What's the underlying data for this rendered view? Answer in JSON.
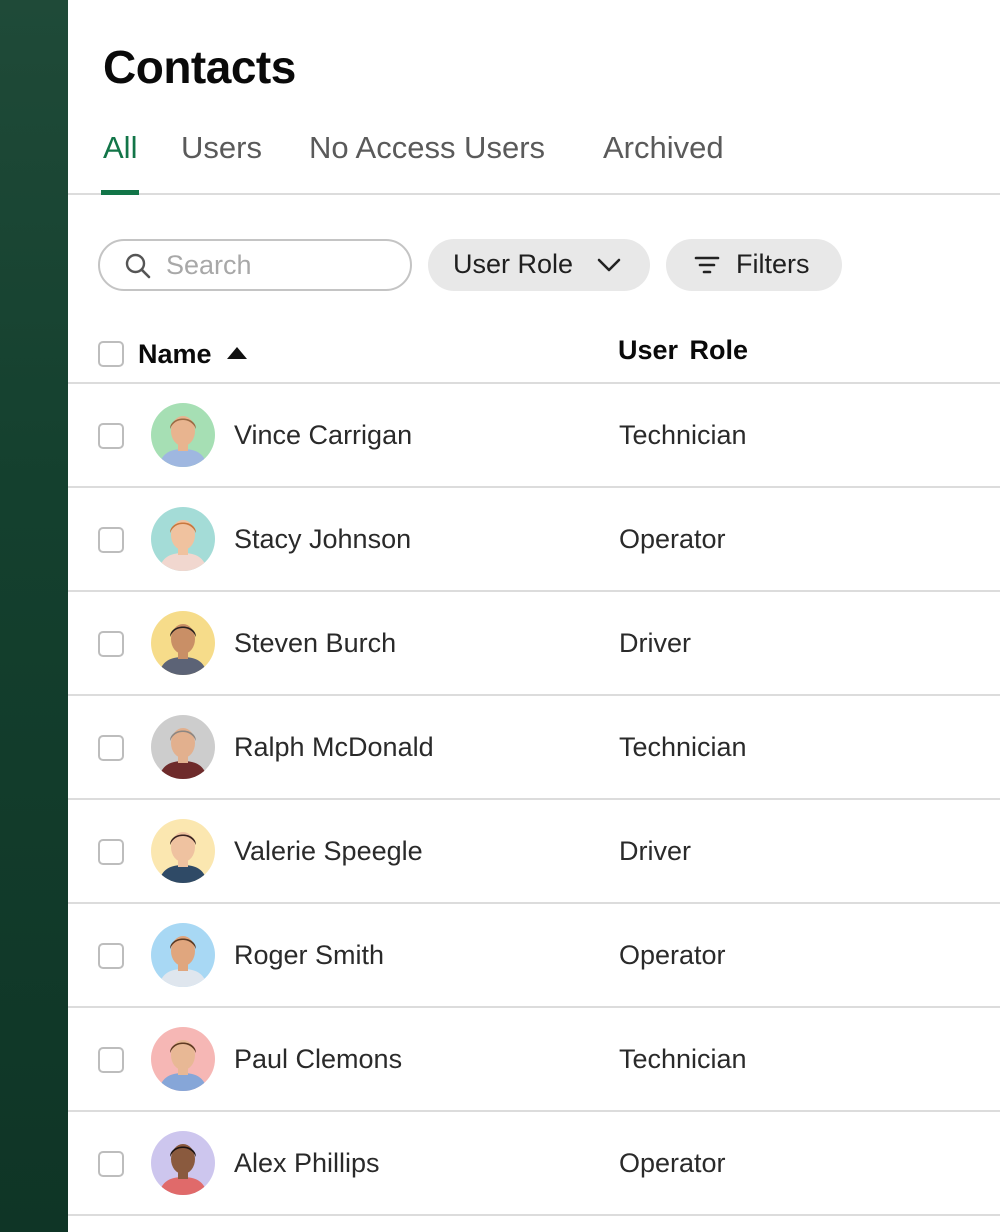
{
  "page": {
    "title": "Contacts"
  },
  "tabs": [
    {
      "label": "All",
      "active": true
    },
    {
      "label": "Users",
      "active": false
    },
    {
      "label": "No Access Users",
      "active": false
    },
    {
      "label": "Archived",
      "active": false
    }
  ],
  "toolbar": {
    "search_placeholder": "Search",
    "search_value": "",
    "role_filter_label": "User Role",
    "filters_label": "Filters"
  },
  "table": {
    "columns": {
      "name": "Name",
      "role": "User  Role"
    },
    "sort": {
      "column": "Name",
      "direction": "ascending"
    },
    "rows": [
      {
        "name": "Vince Carrigan",
        "role": "Technician",
        "avatar_bg": "#a6dfb4",
        "skin": "#e8b48f",
        "hair": "#9a6a43",
        "shirt": "#9fb7e0"
      },
      {
        "name": "Stacy Johnson",
        "role": "Operator",
        "avatar_bg": "#a4dcd7",
        "skin": "#f0c29f",
        "hair": "#c8773d",
        "shirt": "#f1d7cf"
      },
      {
        "name": "Steven Burch",
        "role": "Driver",
        "avatar_bg": "#f6dc8a",
        "skin": "#c98f66",
        "hair": "#2a2220",
        "shirt": "#5c6376"
      },
      {
        "name": "Ralph McDonald",
        "role": "Technician",
        "avatar_bg": "#cdcdcd",
        "skin": "#e2b08e",
        "hair": "#8d8681",
        "shirt": "#6e2b2b"
      },
      {
        "name": "Valerie Speegle",
        "role": "Driver",
        "avatar_bg": "#fbe7b0",
        "skin": "#efc2a0",
        "hair": "#3a2420",
        "shirt": "#2f4a66"
      },
      {
        "name": "Roger Smith",
        "role": "Operator",
        "avatar_bg": "#a8d8f4",
        "skin": "#e0a67e",
        "hair": "#5a3a24",
        "shirt": "#dfe6ee"
      },
      {
        "name": "Paul Clemons",
        "role": "Technician",
        "avatar_bg": "#f6b7b5",
        "skin": "#e8b895",
        "hair": "#5f3a22",
        "shirt": "#86a6d8"
      },
      {
        "name": "Alex Phillips",
        "role": "Operator",
        "avatar_bg": "#cdc6ee",
        "skin": "#8a5a3e",
        "hair": "#1c1412",
        "shirt": "#e06a6a"
      }
    ]
  },
  "colors": {
    "accent": "#127548",
    "sidebar": "#14402e",
    "divider": "#dcdcdc",
    "pill_bg": "#e8e8e8"
  },
  "icons": [
    "search-icon",
    "chevron-down-icon",
    "filter-icon",
    "sort-up-icon",
    "avatar"
  ]
}
